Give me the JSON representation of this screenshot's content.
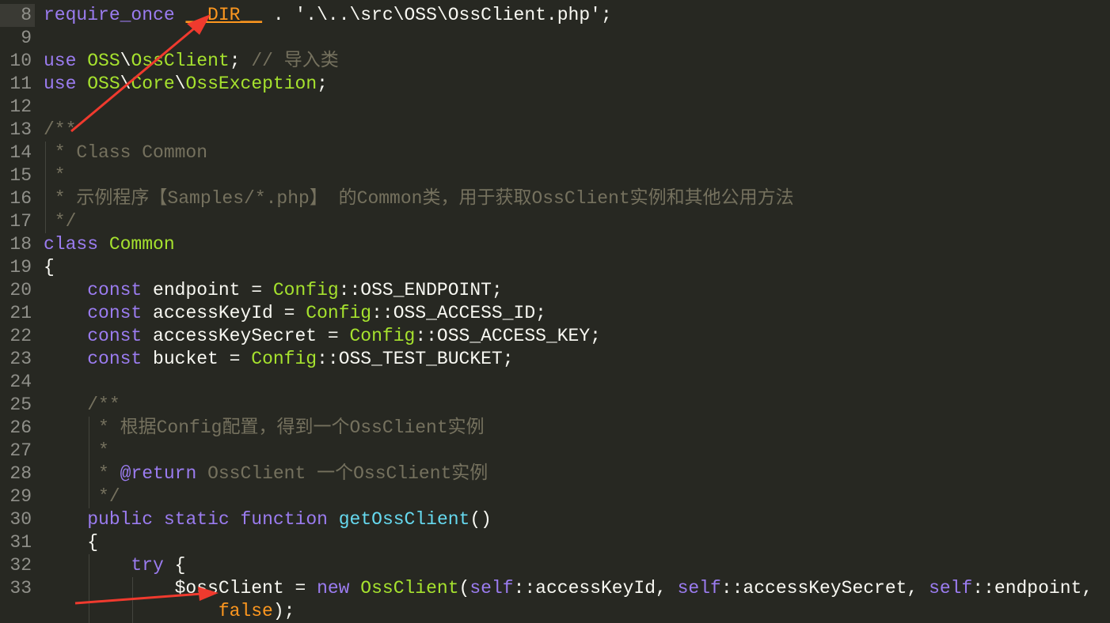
{
  "editor": {
    "colors": {
      "background": "#272822",
      "keyword": "#9b7cf0",
      "class": "#a6e22e",
      "function": "#66d9ef",
      "constant": "#fd971f",
      "comment": "#75715e",
      "annotation_arrow": "#f03a2e"
    },
    "current_line": "8",
    "lines": [
      {
        "num": "8",
        "indent": 0,
        "tokens": [
          [
            "kw",
            "require_once"
          ],
          [
            "",
            ""
          ],
          [
            "",
            " "
          ],
          [
            "const",
            "__DIR__"
          ],
          [
            "",
            " . '.\\..\\src\\OSS\\OssClient.php';"
          ]
        ]
      },
      {
        "num": "9",
        "indent": 0,
        "tokens": []
      },
      {
        "num": "10",
        "indent": 0,
        "tokens": [
          [
            "kw",
            "use"
          ],
          [
            "",
            " "
          ],
          [
            "cls",
            "OSS"
          ],
          [
            "",
            "\\"
          ],
          [
            "cls",
            "OssClient"
          ],
          [
            "",
            "; "
          ],
          [
            "cm",
            "// 导入类"
          ]
        ]
      },
      {
        "num": "11",
        "indent": 0,
        "tokens": [
          [
            "kw",
            "use"
          ],
          [
            "",
            " "
          ],
          [
            "cls",
            "OSS"
          ],
          [
            "",
            "\\"
          ],
          [
            "cls",
            "Core"
          ],
          [
            "",
            "\\"
          ],
          [
            "cls",
            "OssException"
          ],
          [
            "",
            ";"
          ]
        ]
      },
      {
        "num": "12",
        "indent": 0,
        "tokens": []
      },
      {
        "num": "13",
        "indent": 0,
        "tokens": [
          [
            "cm",
            "/**"
          ]
        ]
      },
      {
        "num": "14",
        "indent": 0,
        "guides": [
          0
        ],
        "tokens": [
          [
            "cm",
            " * Class Common"
          ]
        ]
      },
      {
        "num": "15",
        "indent": 0,
        "guides": [
          0
        ],
        "tokens": [
          [
            "cm",
            " *"
          ]
        ]
      },
      {
        "num": "16",
        "indent": 0,
        "guides": [
          0
        ],
        "tokens": [
          [
            "cm",
            " * 示例程序【Samples/*.php】 的Common类，用于获取OssClient实例和其他公用方法"
          ]
        ]
      },
      {
        "num": "17",
        "indent": 0,
        "guides": [
          0
        ],
        "tokens": [
          [
            "cm",
            " */"
          ]
        ]
      },
      {
        "num": "18",
        "indent": 0,
        "tokens": [
          [
            "kw",
            "class"
          ],
          [
            "",
            " "
          ],
          [
            "cls",
            "Common"
          ]
        ]
      },
      {
        "num": "19",
        "indent": 0,
        "tokens": [
          [
            "",
            "{"
          ]
        ]
      },
      {
        "num": "20",
        "indent": 0,
        "tokens": [
          [
            "",
            "    "
          ],
          [
            "kw",
            "const"
          ],
          [
            "",
            " endpoint = "
          ],
          [
            "cls",
            "Config"
          ],
          [
            "",
            "::OSS_ENDPOINT;"
          ]
        ]
      },
      {
        "num": "21",
        "indent": 0,
        "tokens": [
          [
            "",
            "    "
          ],
          [
            "kw",
            "const"
          ],
          [
            "",
            " accessKeyId = "
          ],
          [
            "cls",
            "Config"
          ],
          [
            "",
            "::OSS_ACCESS_ID;"
          ]
        ]
      },
      {
        "num": "22",
        "indent": 0,
        "tokens": [
          [
            "",
            "    "
          ],
          [
            "kw",
            "const"
          ],
          [
            "",
            " accessKeySecret = "
          ],
          [
            "cls",
            "Config"
          ],
          [
            "",
            "::OSS_ACCESS_KEY;"
          ]
        ]
      },
      {
        "num": "23",
        "indent": 0,
        "tokens": [
          [
            "",
            "    "
          ],
          [
            "kw",
            "const"
          ],
          [
            "",
            " bucket = "
          ],
          [
            "cls",
            "Config"
          ],
          [
            "",
            "::OSS_TEST_BUCKET;"
          ]
        ]
      },
      {
        "num": "24",
        "indent": 0,
        "tokens": []
      },
      {
        "num": "25",
        "indent": 0,
        "tokens": [
          [
            "",
            "    "
          ],
          [
            "cm",
            "/**"
          ]
        ]
      },
      {
        "num": "26",
        "indent": 0,
        "guides": [
          4
        ],
        "tokens": [
          [
            "",
            "    "
          ],
          [
            "cm",
            " * 根据Config配置，得到一个OssClient实例"
          ]
        ]
      },
      {
        "num": "27",
        "indent": 0,
        "guides": [
          4
        ],
        "tokens": [
          [
            "",
            "    "
          ],
          [
            "cm",
            " *"
          ]
        ]
      },
      {
        "num": "28",
        "indent": 0,
        "guides": [
          4
        ],
        "tokens": [
          [
            "",
            "    "
          ],
          [
            "cm",
            " * "
          ],
          [
            "cmkw",
            "@return"
          ],
          [
            "cm",
            " OssClient 一个OssClient实例"
          ]
        ]
      },
      {
        "num": "29",
        "indent": 0,
        "guides": [
          4
        ],
        "tokens": [
          [
            "",
            "    "
          ],
          [
            "cm",
            " */"
          ]
        ]
      },
      {
        "num": "30",
        "indent": 0,
        "tokens": [
          [
            "",
            "    "
          ],
          [
            "kw",
            "public"
          ],
          [
            "",
            " "
          ],
          [
            "kw",
            "static"
          ],
          [
            "",
            " "
          ],
          [
            "kw",
            "function"
          ],
          [
            "",
            " "
          ],
          [
            "fn",
            "getOssClient"
          ],
          [
            "",
            "()"
          ]
        ]
      },
      {
        "num": "31",
        "indent": 0,
        "tokens": [
          [
            "",
            "    {"
          ]
        ]
      },
      {
        "num": "32",
        "indent": 0,
        "guides": [
          4
        ],
        "tokens": [
          [
            "",
            "        "
          ],
          [
            "kw",
            "try"
          ],
          [
            "",
            " {"
          ]
        ]
      },
      {
        "num": "33",
        "indent": 0,
        "guides": [
          4,
          8
        ],
        "tokens": [
          [
            "",
            "            $ossClient = "
          ],
          [
            "kw",
            "new"
          ],
          [
            "",
            " "
          ],
          [
            "cls",
            "OssClient"
          ],
          [
            "",
            "("
          ],
          [
            "kw",
            "self"
          ],
          [
            "",
            "::accessKeyId, "
          ],
          [
            "kw",
            "self"
          ],
          [
            "",
            "::accessKeySecret, "
          ],
          [
            "kw",
            "self"
          ],
          [
            "",
            "::endpoint,"
          ]
        ]
      },
      {
        "num": "",
        "indent": 0,
        "guides": [
          4,
          8
        ],
        "tokens": [
          [
            "",
            "                "
          ],
          [
            "bool",
            "false"
          ],
          [
            "",
            ");"
          ]
        ]
      }
    ]
  }
}
